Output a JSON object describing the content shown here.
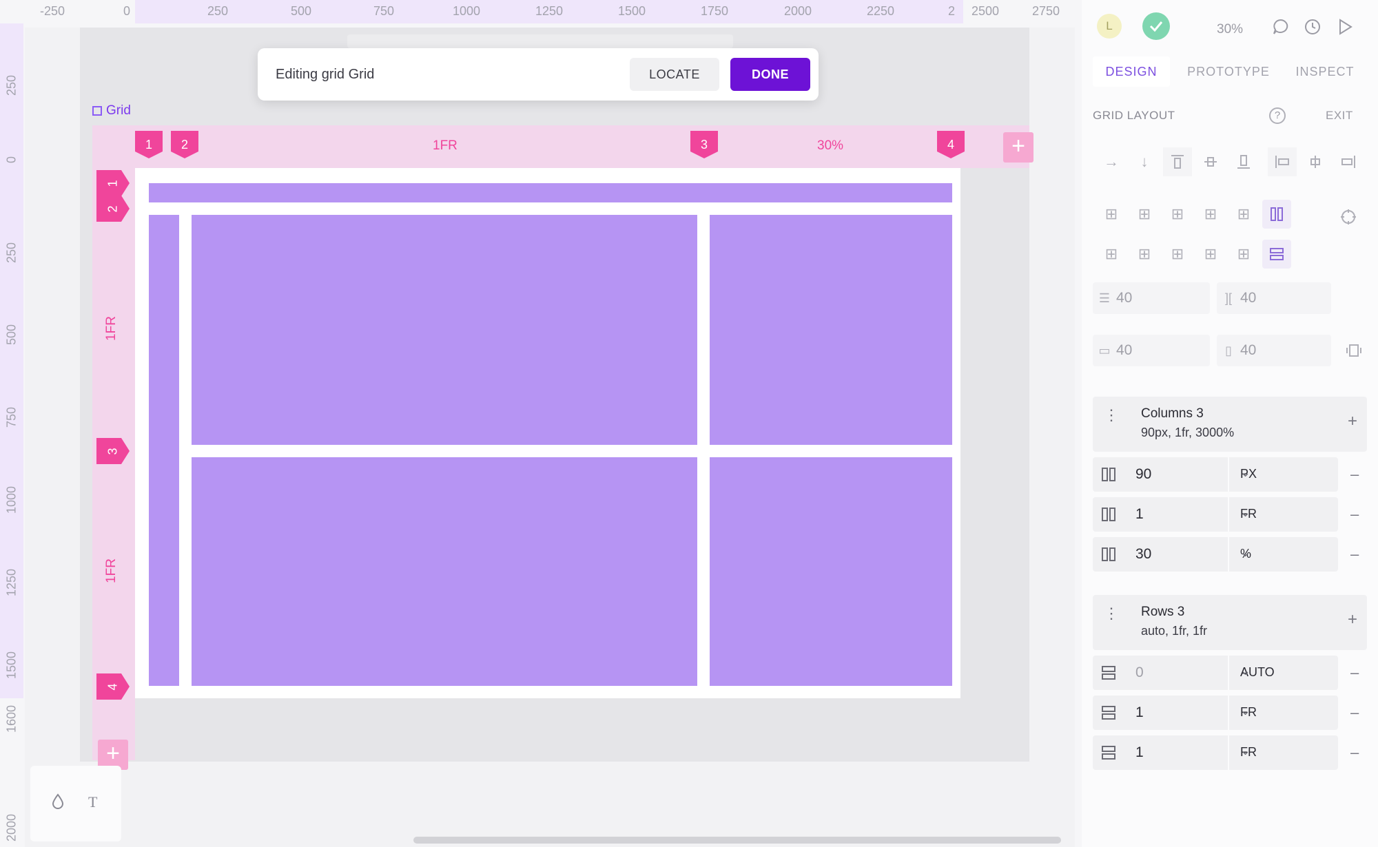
{
  "ruler": {
    "top": [
      "-250",
      "0",
      "250",
      "500",
      "750",
      "1000",
      "1250",
      "1500",
      "1750",
      "2000",
      "2250",
      "2",
      "2500",
      "2750"
    ],
    "left": [
      "250",
      "0",
      "250",
      "500",
      "750",
      "1000",
      "1250",
      "1500",
      "1600",
      "2000"
    ]
  },
  "toolbar": {
    "title": "Editing grid Grid",
    "locate_label": "LOCATE",
    "done_label": "DONE"
  },
  "grid": {
    "label": "Grid",
    "column_markers": [
      "1",
      "2",
      "3",
      "4"
    ],
    "column_track_labels": [
      "1FR",
      "30%"
    ],
    "row_markers": [
      "1",
      "2",
      "3",
      "4"
    ],
    "row_track_labels": [
      "1FR",
      "1FR"
    ],
    "add_symbol": "+"
  },
  "palette": {
    "tools": [
      "drop-icon",
      "text-icon"
    ],
    "text_tool_label": "T"
  },
  "header": {
    "avatar_initial": "L",
    "zoom": "30%",
    "icons": [
      "comment-icon",
      "history-icon",
      "play-icon"
    ]
  },
  "tabs": [
    "DESIGN",
    "PROTOTYPE",
    "INSPECT"
  ],
  "active_tab": "DESIGN",
  "grid_layout": {
    "title": "GRID LAYOUT",
    "exit_label": "EXIT",
    "help_symbol": "?",
    "gaps": {
      "row_gap": "40",
      "column_gap": "40",
      "vertical_padding": "40",
      "horizontal_padding": "40"
    },
    "columns": {
      "title": "Columns 3",
      "summary": "90px, 1fr, 3000%",
      "tracks": [
        {
          "value": "90",
          "unit": "PX"
        },
        {
          "value": "1",
          "unit": "FR"
        },
        {
          "value": "30",
          "unit": "%"
        }
      ]
    },
    "rows": {
      "title": "Rows 3",
      "summary": "auto, 1fr, 1fr",
      "tracks": [
        {
          "value": "0",
          "unit": "AUTO"
        },
        {
          "value": "1",
          "unit": "FR"
        },
        {
          "value": "1",
          "unit": "FR"
        }
      ]
    },
    "plus_symbol": "+",
    "minus_symbol": "–"
  },
  "colors": {
    "accent": "#6d12d6",
    "cell": "#b694f3",
    "marker": "#f0459b",
    "track": "#f3d6ec"
  }
}
